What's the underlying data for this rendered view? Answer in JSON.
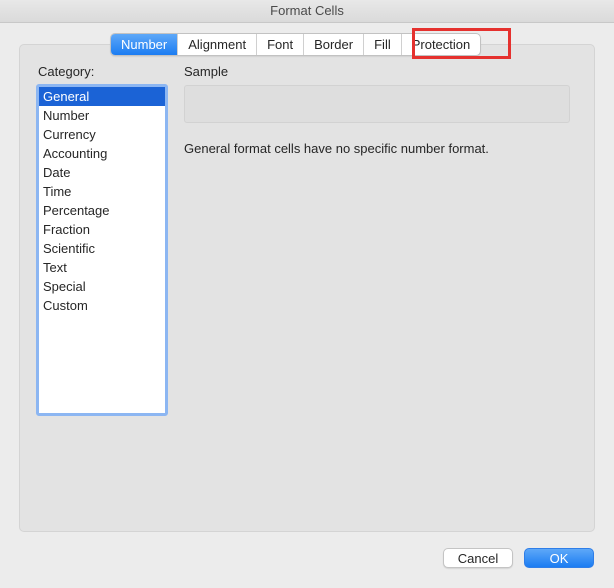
{
  "window": {
    "title": "Format Cells"
  },
  "tabs": [
    {
      "label": "Number",
      "active": true
    },
    {
      "label": "Alignment",
      "active": false
    },
    {
      "label": "Font",
      "active": false
    },
    {
      "label": "Border",
      "active": false
    },
    {
      "label": "Fill",
      "active": false
    },
    {
      "label": "Protection",
      "active": false
    }
  ],
  "category": {
    "label": "Category:",
    "items": [
      "General",
      "Number",
      "Currency",
      "Accounting",
      "Date",
      "Time",
      "Percentage",
      "Fraction",
      "Scientific",
      "Text",
      "Special",
      "Custom"
    ],
    "selected": "General"
  },
  "sample": {
    "label": "Sample",
    "value": ""
  },
  "description": "General format cells have no specific number format.",
  "buttons": {
    "cancel": "Cancel",
    "ok": "OK"
  },
  "colors": {
    "accent": "#1b7cf2",
    "selection": "#1b63d6",
    "highlight": "#e5312e"
  }
}
